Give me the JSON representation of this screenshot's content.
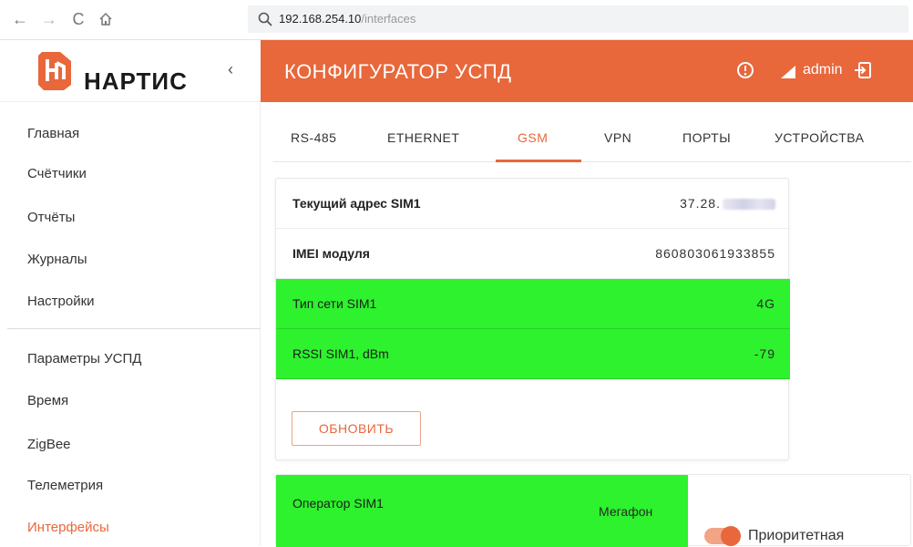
{
  "browser": {
    "back_glyph": "←",
    "forward_glyph": "→",
    "reload_glyph": "C",
    "url_host": "192.168.254.10",
    "url_path": "/interfaces"
  },
  "sidebar": {
    "logo_text": "НАРТИС",
    "collapse_glyph": "‹",
    "items": [
      {
        "label": "Главная"
      },
      {
        "label": "Счётчики"
      },
      {
        "label": "Отчёты"
      },
      {
        "label": "Журналы"
      },
      {
        "label": "Настройки"
      },
      {
        "label": "Параметры УСПД"
      },
      {
        "label": "Время"
      },
      {
        "label": "ZigBee"
      },
      {
        "label": "Телеметрия"
      },
      {
        "label": "Интерфейсы"
      }
    ]
  },
  "header": {
    "title": "КОНФИГУРАТОР УСПД",
    "user": "admin"
  },
  "tabs": [
    {
      "label": "RS-485"
    },
    {
      "label": "ETHERNET"
    },
    {
      "label": "GSM"
    },
    {
      "label": "VPN"
    },
    {
      "label": "ПОРТЫ"
    },
    {
      "label": "УСТРОЙСТВА"
    }
  ],
  "gsm_info": {
    "rows": [
      {
        "label": "Текущий адрес SIM1",
        "value": "37.28."
      },
      {
        "label": "IMEI модуля",
        "value": "860803061933855"
      },
      {
        "label": "Тип сети SIM1",
        "value": "4G"
      },
      {
        "label": "RSSI SIM1, dBm",
        "value": "-79"
      }
    ],
    "refresh_label": "ОБНОВИТЬ"
  },
  "operator": {
    "label": "Оператор SIM1",
    "value": "Мегафон",
    "priority_label": "Приоритетная"
  },
  "colors": {
    "accent": "#e8673b",
    "status_green": "#2df22d"
  }
}
